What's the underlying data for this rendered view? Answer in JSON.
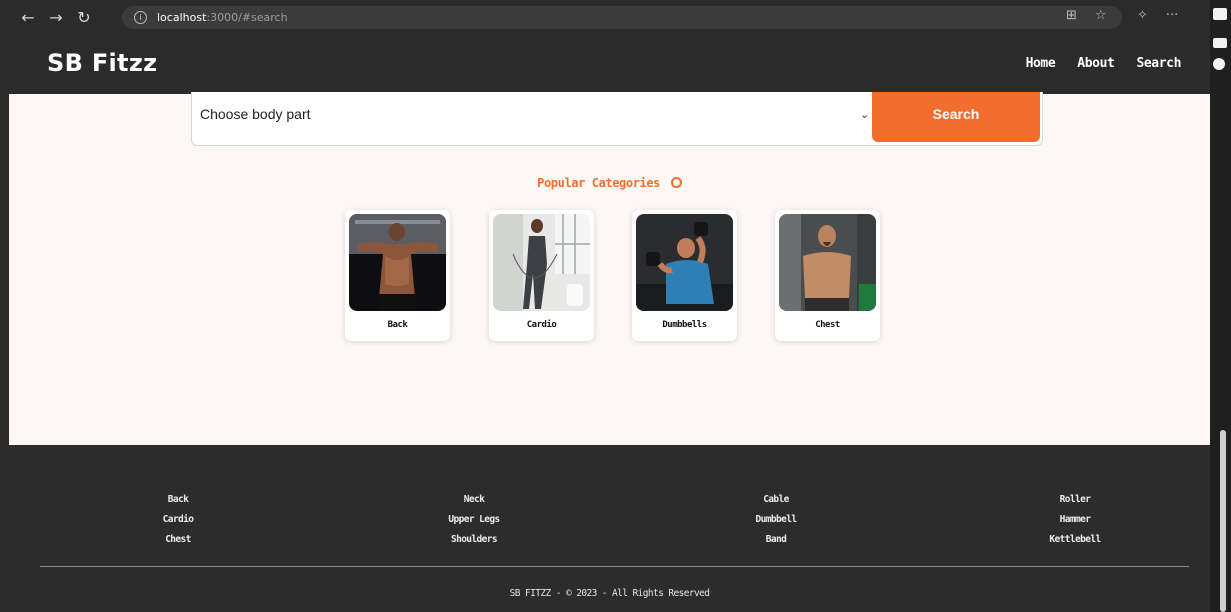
{
  "browser": {
    "url_host": "localhost",
    "url_rest": ":3000/#search",
    "back_icon": "arrow-left-icon",
    "forward_icon": "arrow-right-icon",
    "reload_icon": "reload-icon",
    "more": "···"
  },
  "header": {
    "brand": "SB Fitzz",
    "nav": [
      "Home",
      "About",
      "Search"
    ]
  },
  "search": {
    "select_value": "Choose body part",
    "button_label": "Search"
  },
  "popular": {
    "title": "Popular Categories",
    "items": [
      {
        "label": "Back",
        "icon": "back-workout-image"
      },
      {
        "label": "Cardio",
        "icon": "cardio-workout-image"
      },
      {
        "label": "Dumbbells",
        "icon": "dumbbells-workout-image"
      },
      {
        "label": "Chest",
        "icon": "chest-workout-image"
      }
    ]
  },
  "footer": {
    "columns": [
      [
        "Back",
        "Cardio",
        "Chest"
      ],
      [
        "Neck",
        "Upper Legs",
        "Shoulders"
      ],
      [
        "Cable",
        "Dumbbell",
        "Band"
      ],
      [
        "Roller",
        "Hammer",
        "Kettlebell"
      ]
    ],
    "copyright": "SB FITZZ - © 2023 - All Rights Reserved"
  },
  "colors": {
    "accent": "#f26e2f",
    "dark": "#2b2b2b",
    "page_bg": "#fdf8f6"
  }
}
